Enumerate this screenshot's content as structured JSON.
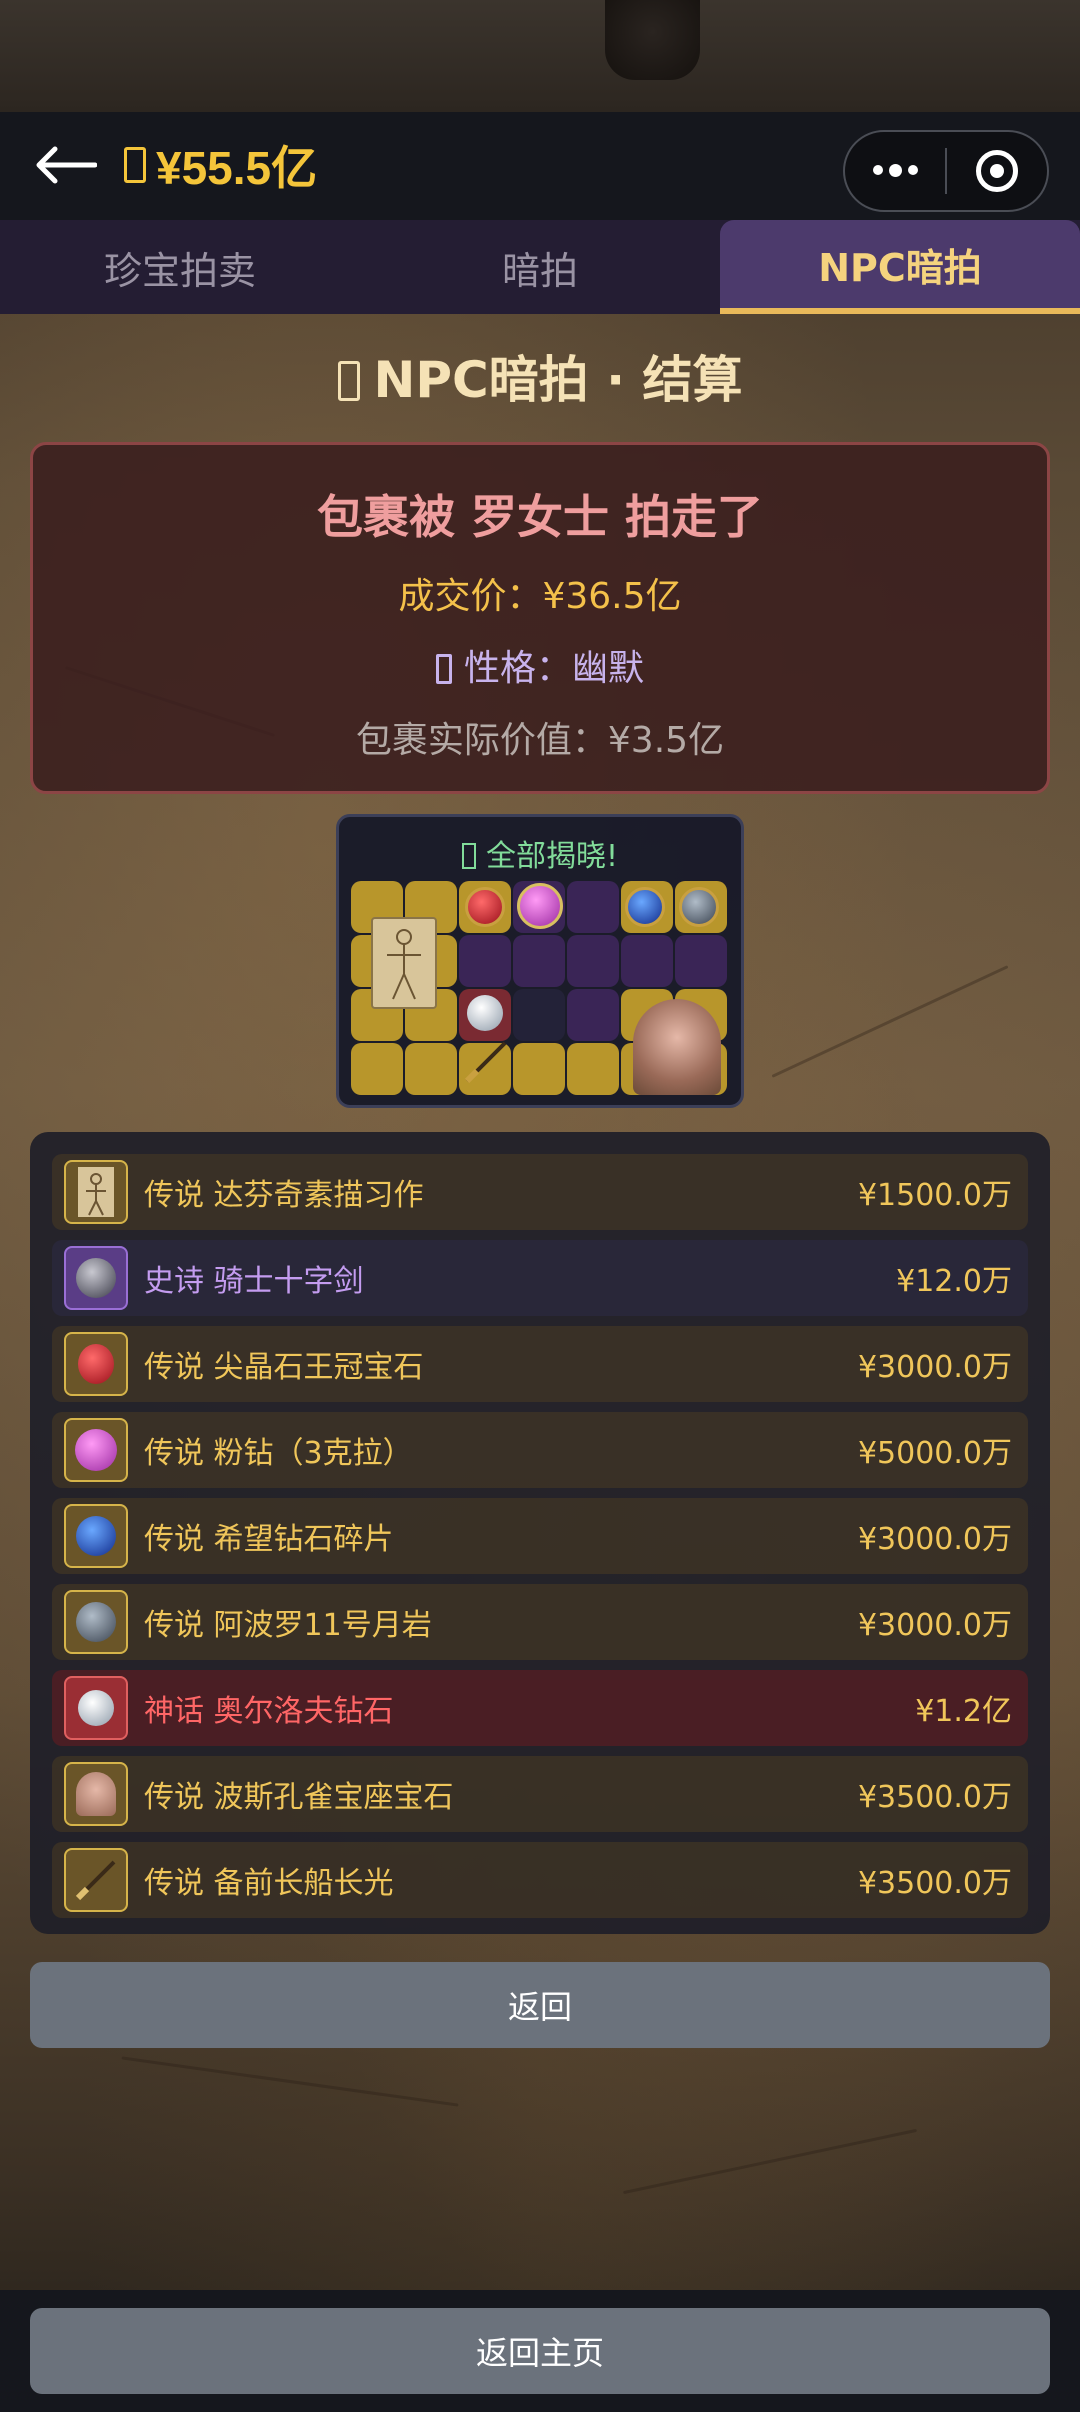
{
  "header": {
    "money": "¥55.5亿",
    "back_icon": "arrow-left-icon",
    "more_icon": "more-dots-icon",
    "close_icon": "target-icon"
  },
  "tabs": [
    {
      "label": "珍宝拍卖",
      "active": false
    },
    {
      "label": "暗拍",
      "active": false
    },
    {
      "label": "NPC暗拍",
      "active": true
    }
  ],
  "page_title": "NPC暗拍 · 结算",
  "result": {
    "winner": "包裹被 罗女士 拍走了",
    "deal_price": "成交价：¥36.5亿",
    "personality": "性格：幽默",
    "actual_value": "包裹实际价值：¥3.5亿"
  },
  "reveal": {
    "title": "全部揭晓!"
  },
  "items": [
    {
      "rarity": "legendary",
      "label": "传说 达芬奇素描习作",
      "value": "¥1500.0万"
    },
    {
      "rarity": "epic",
      "label": "史诗 骑士十字剑",
      "value": "¥12.0万"
    },
    {
      "rarity": "legendary",
      "label": "传说 尖晶石王冠宝石",
      "value": "¥3000.0万"
    },
    {
      "rarity": "legendary",
      "label": "传说 粉钻（3克拉）",
      "value": "¥5000.0万"
    },
    {
      "rarity": "legendary",
      "label": "传说 希望钻石碎片",
      "value": "¥3000.0万"
    },
    {
      "rarity": "legendary",
      "label": "传说 阿波罗11号月岩",
      "value": "¥3000.0万"
    },
    {
      "rarity": "mythic",
      "label": "神话 奥尔洛夫钻石",
      "value": "¥1.2亿"
    },
    {
      "rarity": "legendary",
      "label": "传说 波斯孔雀宝座宝石",
      "value": "¥3500.0万"
    },
    {
      "rarity": "legendary",
      "label": "传说 备前长船长光",
      "value": "¥3500.0万"
    }
  ],
  "buttons": {
    "back": "返回",
    "home": "返回主页"
  }
}
